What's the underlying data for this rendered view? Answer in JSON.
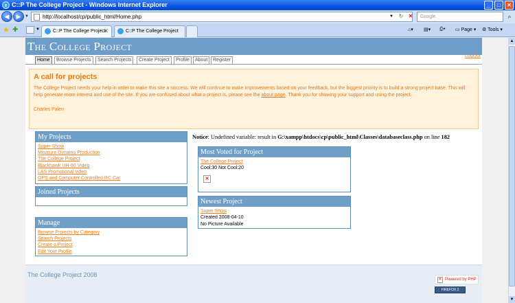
{
  "browser": {
    "window_title": "C::P The College Project - Windows Internet Explorer",
    "url": "http://localhost/cp/public_html/Home.php",
    "search_placeholder": "Google",
    "tabs": [
      {
        "label": "C::P The College Project",
        "active": true
      },
      {
        "label": "C::P The College Project",
        "active": false
      }
    ],
    "commands": {
      "page": "Page",
      "tools": "Tools"
    }
  },
  "site": {
    "title": "The College Project",
    "logout": "LogOut",
    "nav": [
      "Home",
      "Browse Projects",
      "Search Projects",
      "Create Project",
      "Profile",
      "About",
      "Register"
    ],
    "current_nav": "Home",
    "callout": {
      "heading": "A call for projects",
      "text_before_link": "The College Project needs your help in order to make this site a success. We will continue to make improvements based on your feedback, but the biggest priority is to build a strong project base. This will help generate more interest and use of the site. If you are confused about what a project is, please see the",
      "link": "about page",
      "text_after_link": ". Thank you for showing your support and using the project.",
      "signature": "Charles Palen"
    },
    "my_projects": {
      "heading": "My Projects",
      "items": [
        "Super Show",
        "Minature Dynamo Production",
        "The College Project",
        "Blackhawk UH-60 Video",
        "LAS Promotional video",
        "GPS and Computer Controlled RC Car"
      ]
    },
    "joined_projects": {
      "heading": "Joined Projects"
    },
    "manage": {
      "heading": "Manage",
      "items": [
        "Browse Projects by Category",
        "Search Projects",
        "Create a Project",
        "Edit Your Profile"
      ]
    },
    "notice": {
      "label": "Notice",
      "message": ": Undefined variable: result in",
      "path": "G:\\xampp\\htdocs\\cp\\public_html\\Classes\\databaseclass.php",
      "line_text": "on line",
      "line": "182"
    },
    "most_voted": {
      "heading": "Most Voted for Project",
      "project": "The College Project",
      "votes": "Cool:30 Not Cool:20"
    },
    "newest": {
      "heading": "Newest Project",
      "project": "Super Show",
      "created": "Created 2008-04-10",
      "picture": "No Picture Available"
    },
    "footer": {
      "copyright": "The College Project 2008",
      "powered_by": "Powered by PHP",
      "firefox": "FIREFOX 2"
    }
  }
}
